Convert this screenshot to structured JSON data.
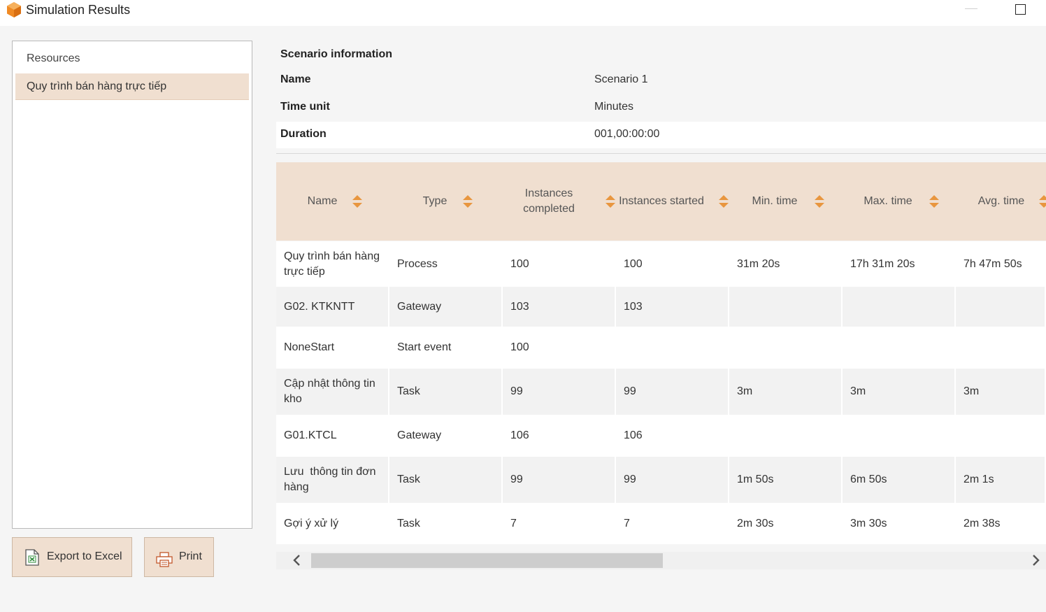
{
  "window": {
    "title": "Simulation Results",
    "icon": "app-cube-icon",
    "controls": [
      "minimize-icon",
      "maximize-icon"
    ]
  },
  "sidebar": {
    "header": "Resources",
    "items": [
      {
        "label": "Quy trình bán hàng trực tiếp",
        "selected": true
      }
    ]
  },
  "buttons": {
    "export_label": "Export to Excel",
    "export_icon": "excel-file-icon",
    "print_label": "Print",
    "print_icon": "printer-icon"
  },
  "scenario": {
    "title": "Scenario information",
    "rows": [
      {
        "key": "Name",
        "value": "Scenario 1"
      },
      {
        "key": "Time unit",
        "value": "Minutes"
      },
      {
        "key": "Duration",
        "value": "001,00:00:00"
      }
    ]
  },
  "table": {
    "columns": [
      {
        "label": "Name"
      },
      {
        "label": "Type"
      },
      {
        "label": "Instances completed"
      },
      {
        "label": "Instances started"
      },
      {
        "label": "Min. time"
      },
      {
        "label": "Max. time"
      },
      {
        "label": "Avg. time"
      }
    ],
    "rows": [
      [
        "Quy trình bán hàng trực tiếp",
        "Process",
        "100",
        "100",
        "31m 20s",
        "17h 31m 20s",
        "7h 47m 50s"
      ],
      [
        "G02. KTKNTT",
        "Gateway",
        "103",
        "103",
        "",
        "",
        ""
      ],
      [
        "NoneStart",
        "Start event",
        "100",
        "",
        "",
        "",
        ""
      ],
      [
        "Cập nhật thông tin kho",
        "Task",
        "99",
        "99",
        "3m",
        "3m",
        "3m"
      ],
      [
        "G01.KTCL",
        "Gateway",
        "106",
        "106",
        "",
        "",
        ""
      ],
      [
        "Lưu  thông tin đơn hàng",
        "Task",
        "99",
        "99",
        "1m 50s",
        "6m 50s",
        "2m 1s"
      ],
      [
        "Gợi ý xử lý",
        "Task",
        "7",
        "7",
        "2m 30s",
        "3m 30s",
        "2m 38s"
      ]
    ]
  },
  "colors": {
    "accent": "#f0dfd0",
    "sort_arrow": "#e8963f",
    "app_icon": "#f08a24"
  }
}
